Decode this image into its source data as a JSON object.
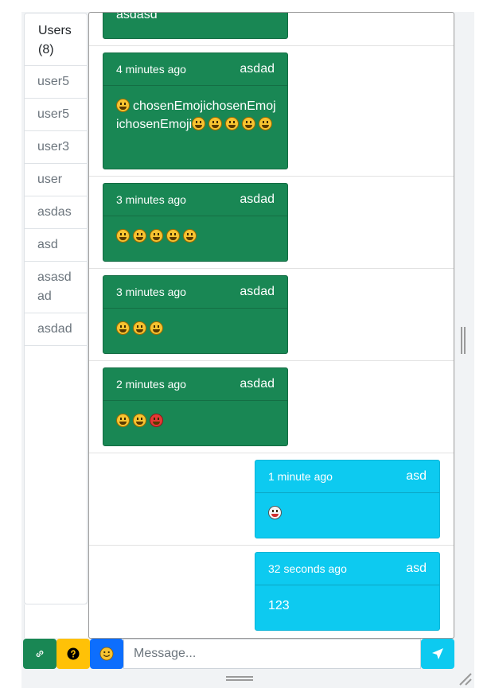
{
  "users": {
    "header": "Users (8)",
    "items": [
      "user5",
      "user5",
      "user3",
      "user",
      "asdas",
      "asd",
      "asasdad",
      "asdad"
    ]
  },
  "messages": [
    {
      "side": "left",
      "time": "",
      "sender": "",
      "text": "asdasd"
    },
    {
      "side": "left",
      "time": "4 minutes ago",
      "sender": "asdad",
      "text": "chosenEmojichosenEmojichosenEmoji",
      "emojis_before": 1,
      "emojis_after": 5
    },
    {
      "side": "left",
      "time": "3 minutes ago",
      "sender": "asdad",
      "text": "",
      "emojis": 5
    },
    {
      "side": "left",
      "time": "3 minutes ago",
      "sender": "asdad",
      "text": "",
      "emojis": 3
    },
    {
      "side": "left",
      "time": "2 minutes ago",
      "sender": "asdad",
      "text": "",
      "emojis": 3
    },
    {
      "side": "right",
      "time": "1 minute ago",
      "sender": "asd",
      "text": "",
      "emojis": 1
    },
    {
      "side": "right",
      "time": "32 seconds ago",
      "sender": "asd",
      "text": "123"
    }
  ],
  "composer": {
    "placeholder": "Message..."
  },
  "icons": {
    "link": "link-icon",
    "help": "question-circle-icon",
    "emoji": "smiley-icon",
    "send": "send-icon"
  },
  "colors": {
    "sent": "#198754",
    "received": "#0dcaf0",
    "emoji_button": "#0d6efd",
    "help_button": "#ffc107"
  }
}
